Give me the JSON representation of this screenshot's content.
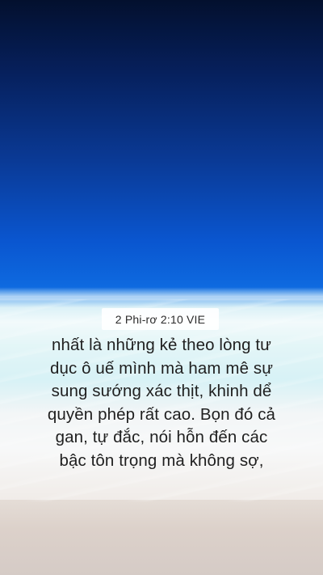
{
  "background": {
    "sky_color": "#0a56d0",
    "overlay_color": "rgba(255,255,255,0.45)"
  },
  "reference": "2 Phi-rơ 2:10 VIE",
  "verse_lines": [
    "nhất là những kẻ theo lòng tư",
    "dục ô uế mình mà ham mê sự",
    "sung sướng xác thịt, khinh dể",
    "quyền phép rất cao. Bọn đó cả",
    "gan, tự đắc, nói hỗn đến các",
    "bậc tôn trọng mà không sợ,"
  ]
}
